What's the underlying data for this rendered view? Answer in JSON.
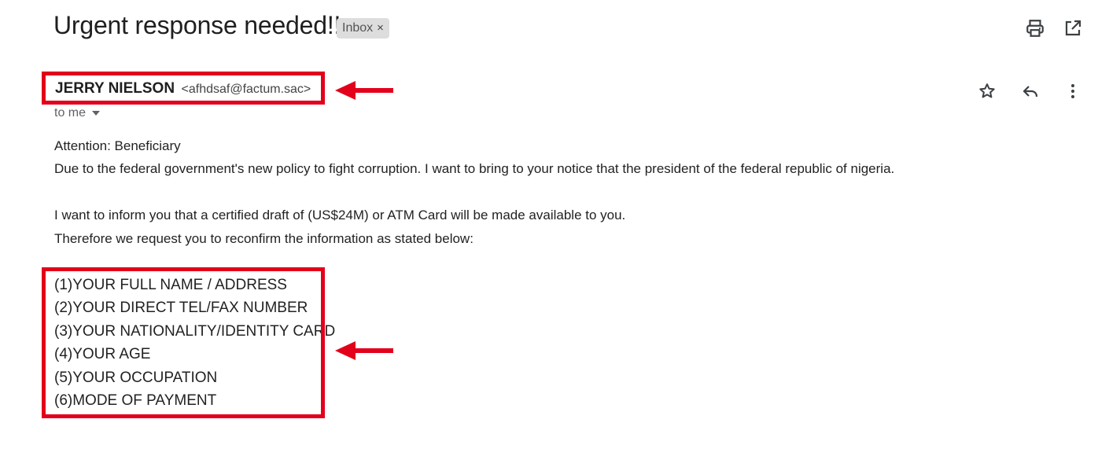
{
  "header": {
    "subject": "Urgent response needed!!",
    "label_chip": "Inbox",
    "label_chip_close": "×",
    "icons": [
      "print-icon",
      "open-in-new-window-icon"
    ]
  },
  "message": {
    "sender_name": "JERRY NIELSON",
    "sender_email": "<afhdsaf@factum.sac>",
    "recipient": "to me",
    "actions": [
      "star-icon",
      "reply-icon",
      "more-options-icon"
    ],
    "body": [
      "Attention: Beneficiary",
      "Due to the federal government's new policy to fight corruption. I want to bring to your notice that the president of the federal republic of nigeria.",
      "I want to inform you that a certified draft of (US$24M) or ATM Card will be made available to you.",
      "Therefore we request you to reconfirm the information as stated below:"
    ],
    "requested_info": [
      "(1)YOUR FULL NAME / ADDRESS",
      "(2)YOUR DIRECT TEL/FAX NUMBER",
      "(3)YOUR NATIONALITY/IDENTITY CARD",
      "(4)YOUR AGE",
      "(5)YOUR OCCUPATION",
      "(6)MODE OF PAYMENT"
    ]
  },
  "annotations": {
    "highlight_color": "#e3001b"
  }
}
